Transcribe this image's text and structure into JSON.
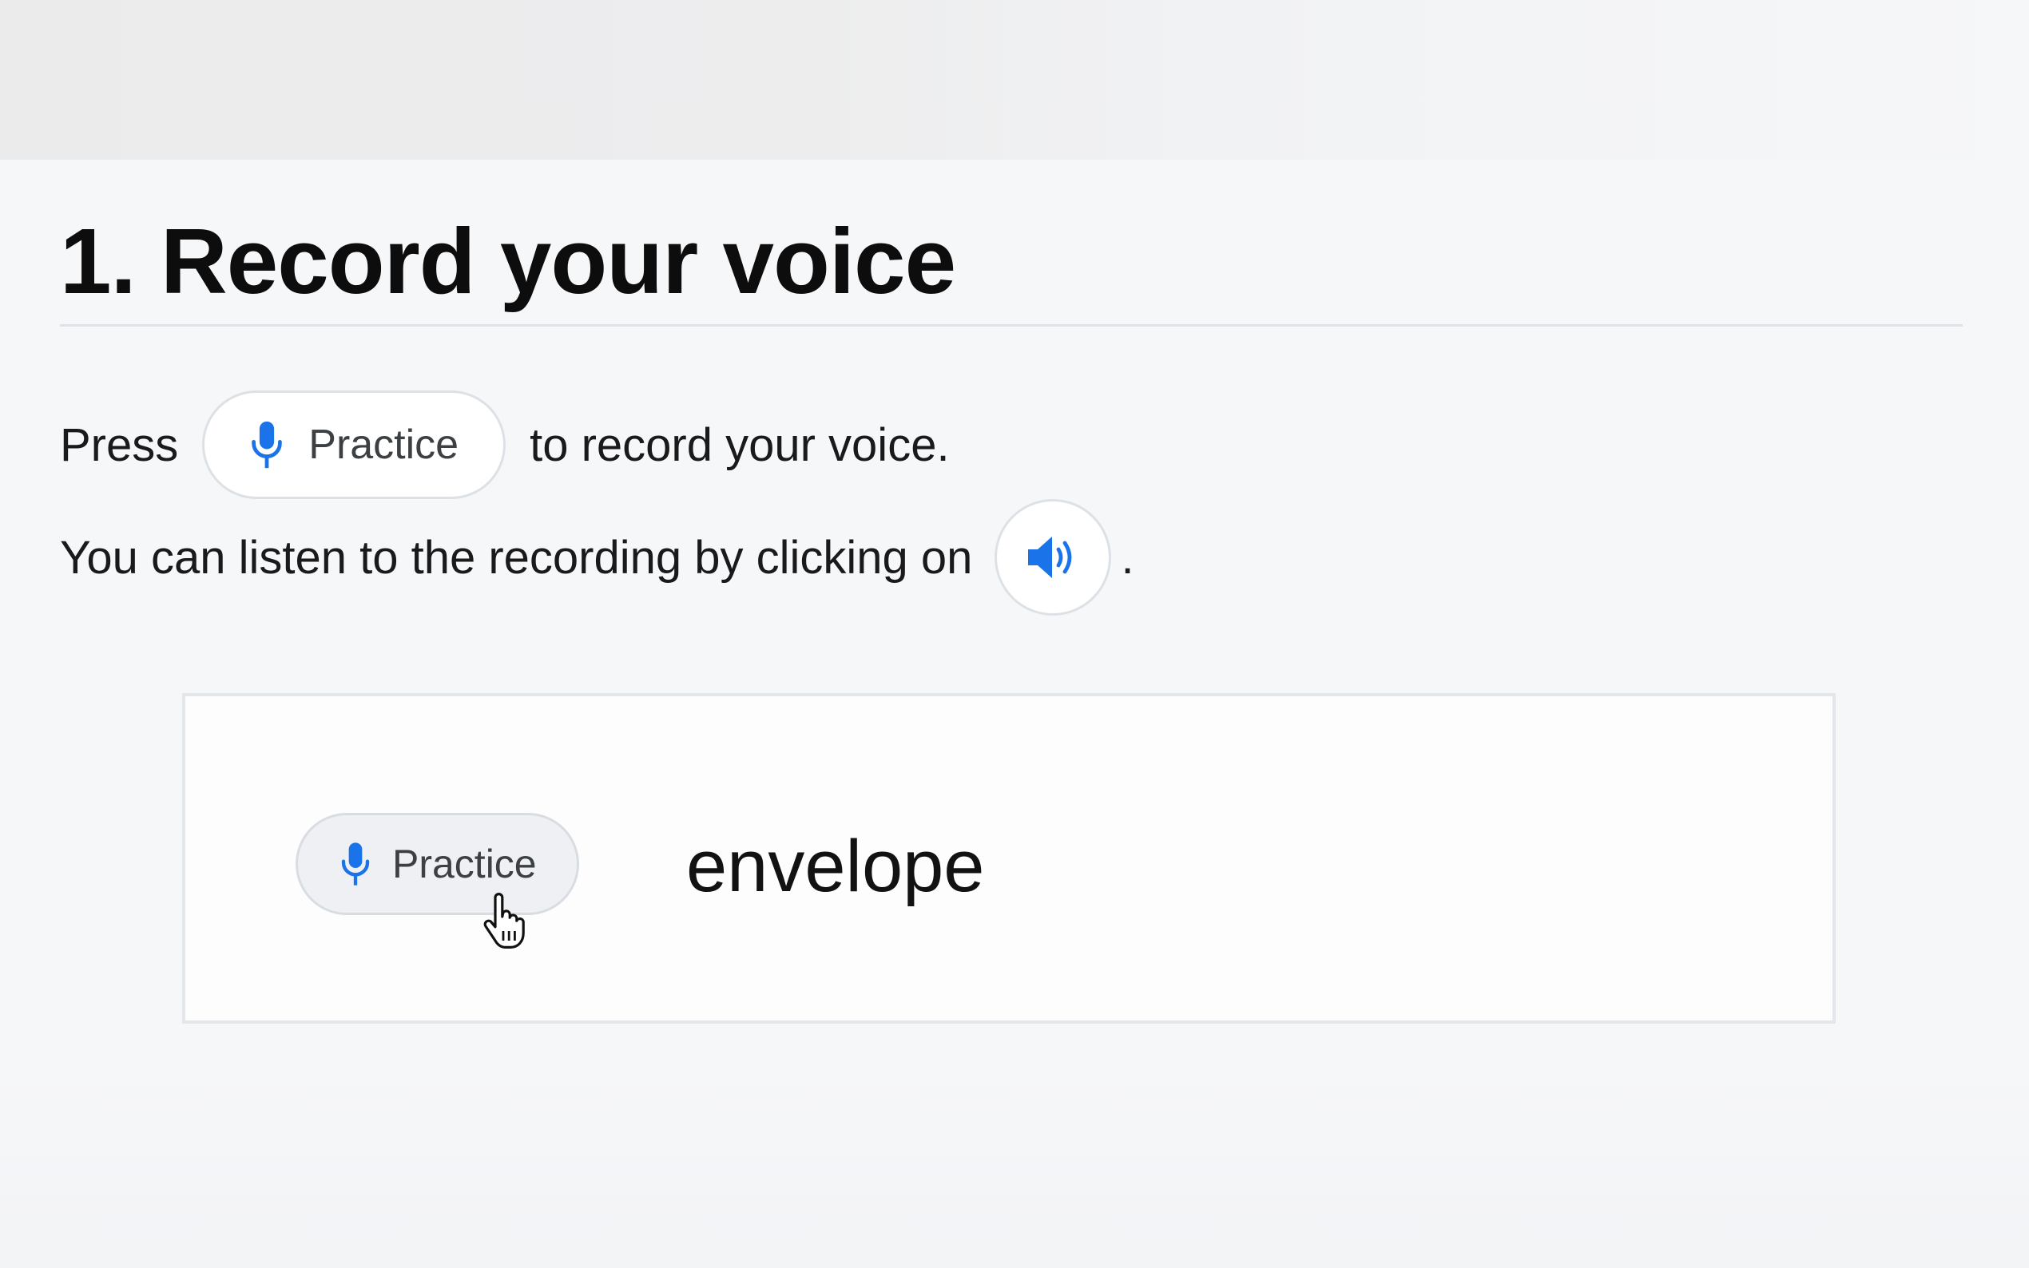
{
  "title": "1. Record your voice",
  "instructions": {
    "line1_before": "Press",
    "practice_button_label": "Practice",
    "line1_after": "to record your voice.",
    "line2_before": "You can listen to the recording by clicking on",
    "line2_after": "."
  },
  "demo": {
    "practice_button_label": "Practice",
    "word": "envelope"
  },
  "icons": {
    "microphone": "microphone-icon",
    "speaker": "speaker-icon",
    "cursor": "hand-pointer-cursor"
  },
  "colors": {
    "accent_blue": "#1a73e8",
    "title_text": "#0d0d0d",
    "body_text": "#1a1a1a",
    "pill_text": "#3c4043",
    "background": "#f6f7f9"
  }
}
